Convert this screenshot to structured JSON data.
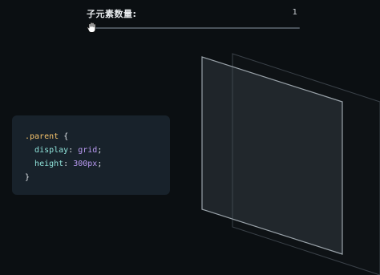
{
  "control": {
    "label": "子元素数量:",
    "value": "1",
    "slider": {
      "min": 1,
      "max": 100,
      "current": 1
    }
  },
  "code": {
    "selector": ".parent",
    "open_brace": "{",
    "close_brace": "}",
    "declarations": [
      {
        "property": "display",
        "value": "grid"
      },
      {
        "property": "height",
        "value": "300px"
      }
    ]
  },
  "colors": {
    "background": "#0b0f12",
    "card": "#18222b",
    "selector": "#f5c26b",
    "property": "#8fe3da",
    "value": "#b99af2"
  },
  "icons": {
    "slider_handle": "grab-hand-icon"
  }
}
